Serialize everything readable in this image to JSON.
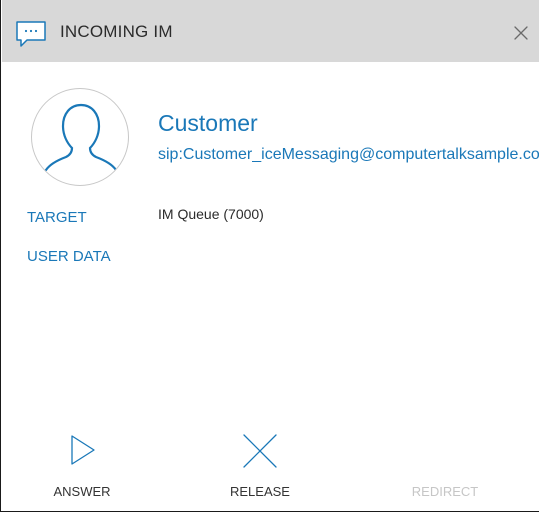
{
  "window": {
    "title": "INCOMING IM",
    "title_icon": "chat-bubble-icon",
    "close_icon": "close-icon"
  },
  "contact": {
    "avatar_icon": "person-outline-icon",
    "name": "Customer",
    "sip": "sip:Customer_iceMessaging@computertalksample.com"
  },
  "details": {
    "target_label": "TARGET",
    "target_value": "IM Queue (7000)",
    "user_data_label": "USER DATA"
  },
  "actions": {
    "answer_label": "ANSWER",
    "release_label": "RELEASE",
    "redirect_label": "REDIRECT",
    "redirect_enabled": false
  },
  "colors": {
    "accent": "#1a78b8",
    "titlebar": "#d8d8d8",
    "disabled_text": "#c6c6c6",
    "text": "#2b2b2b"
  }
}
